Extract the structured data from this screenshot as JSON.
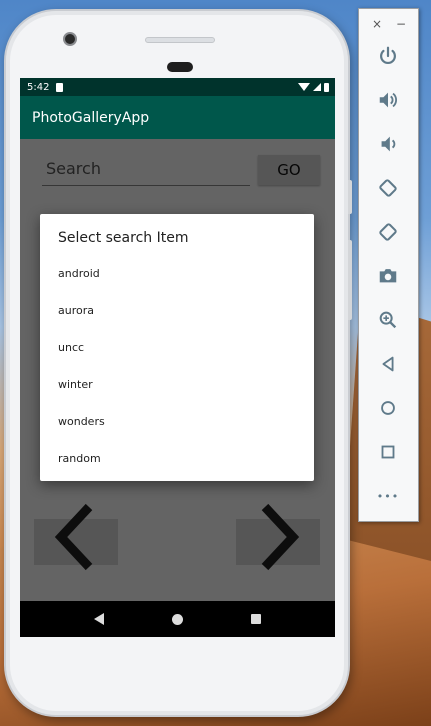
{
  "status_bar": {
    "time": "5:42"
  },
  "app": {
    "title": "PhotoGalleryApp"
  },
  "search": {
    "placeholder": "Search",
    "go_label": "GO"
  },
  "dialog": {
    "title": "Select search Item",
    "items": [
      "android",
      "aurora",
      "uncc",
      "winter",
      "wonders",
      "random"
    ]
  },
  "emulator_panel": {
    "close_label": "×",
    "minimize_label": "−",
    "more_label": "•••"
  },
  "colors": {
    "status_bar": "#00332c",
    "app_bar": "#00574b",
    "dialog_bg": "#ffffff",
    "icon": "#5f7a8a"
  },
  "icons": [
    "power-icon",
    "volume-up-icon",
    "volume-down-icon",
    "rotate-left-icon",
    "rotate-right-icon",
    "camera-icon",
    "zoom-icon",
    "back-icon",
    "home-icon",
    "overview-icon",
    "more-icon"
  ]
}
